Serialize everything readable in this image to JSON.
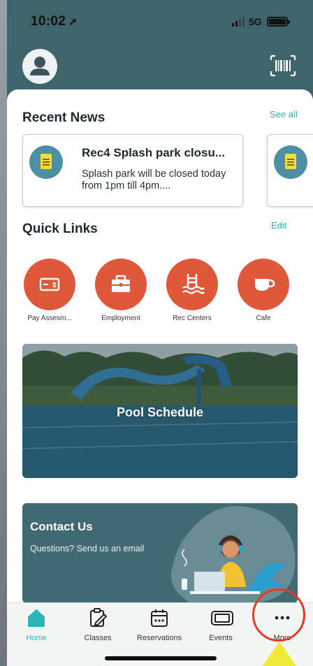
{
  "status_bar": {
    "time": "10:02",
    "network": "5G"
  },
  "recent_news": {
    "title": "Recent News",
    "see_all_label": "See all",
    "items": [
      {
        "title": "Rec4 Splash park closu...",
        "body": "Splash park will be closed today from 1pm till 4pm...."
      }
    ]
  },
  "quick_links": {
    "title": "Quick Links",
    "edit_label": "Edit",
    "items": [
      {
        "label": "Pay Assesm...",
        "icon": "payment-card-icon"
      },
      {
        "label": "Employment",
        "icon": "briefcase-icon"
      },
      {
        "label": "Rec Centers",
        "icon": "pool-ladder-icon"
      },
      {
        "label": "Cafe",
        "icon": "coffee-cup-icon"
      }
    ]
  },
  "pool_banner": {
    "title": "Pool Schedule"
  },
  "contact": {
    "title": "Contact Us",
    "subtitle": "Questions? Send us an email"
  },
  "tab_bar": {
    "items": [
      {
        "label": "Home",
        "icon": "home-icon",
        "active": true
      },
      {
        "label": "Classes",
        "icon": "clipboard-edit-icon",
        "active": false
      },
      {
        "label": "Reservations",
        "icon": "calendar-icon",
        "active": false
      },
      {
        "label": "Events",
        "icon": "ticket-icon",
        "active": false
      },
      {
        "label": "More",
        "icon": "more-dots-icon",
        "active": false
      }
    ]
  },
  "colors": {
    "header_bg": "#3f6469",
    "accent": "#2bb5b8",
    "quick_link_bg": "#e0583a",
    "highlight_ring": "#e53a23",
    "pointer": "#f0ea3a"
  }
}
